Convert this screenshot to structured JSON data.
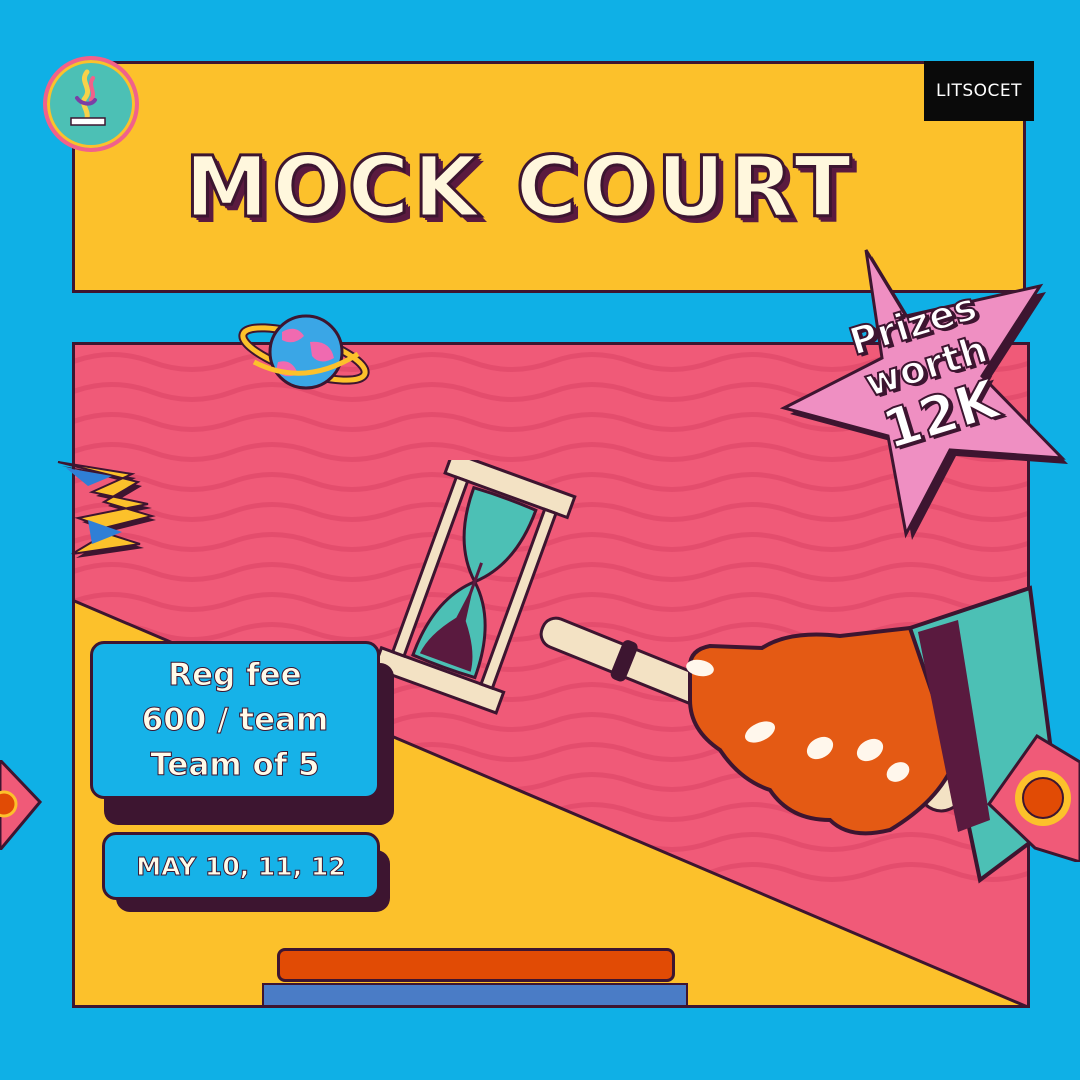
{
  "brand": {
    "label": "LITSOCET"
  },
  "title": "MOCK COURT",
  "prize": {
    "line1": "Prizes",
    "line2": "worth",
    "line3": "12K"
  },
  "registration": {
    "fee_label": "Reg fee",
    "fee_value": "600 / team",
    "team_size": "Team of 5"
  },
  "dates": "MAY 10, 11, 12",
  "colors": {
    "background": "#0fb0e6",
    "header_panel": "#fcc12b",
    "main_panel": "#f05a78",
    "star": "#ef8fc2",
    "info_box": "#16b2e8",
    "outline": "#3d1530",
    "hand": "#e45a14",
    "sleeve": "#4cc0b5",
    "pedestal_top": "#e14b05",
    "pedestal_base": "#4a7cc6"
  },
  "icons": [
    "logo-emblem-icon",
    "planet-icon",
    "lightning-bolt-icon",
    "hourglass-icon",
    "gavel-hand-icon",
    "star-badge-icon",
    "sun-card-icon"
  ]
}
